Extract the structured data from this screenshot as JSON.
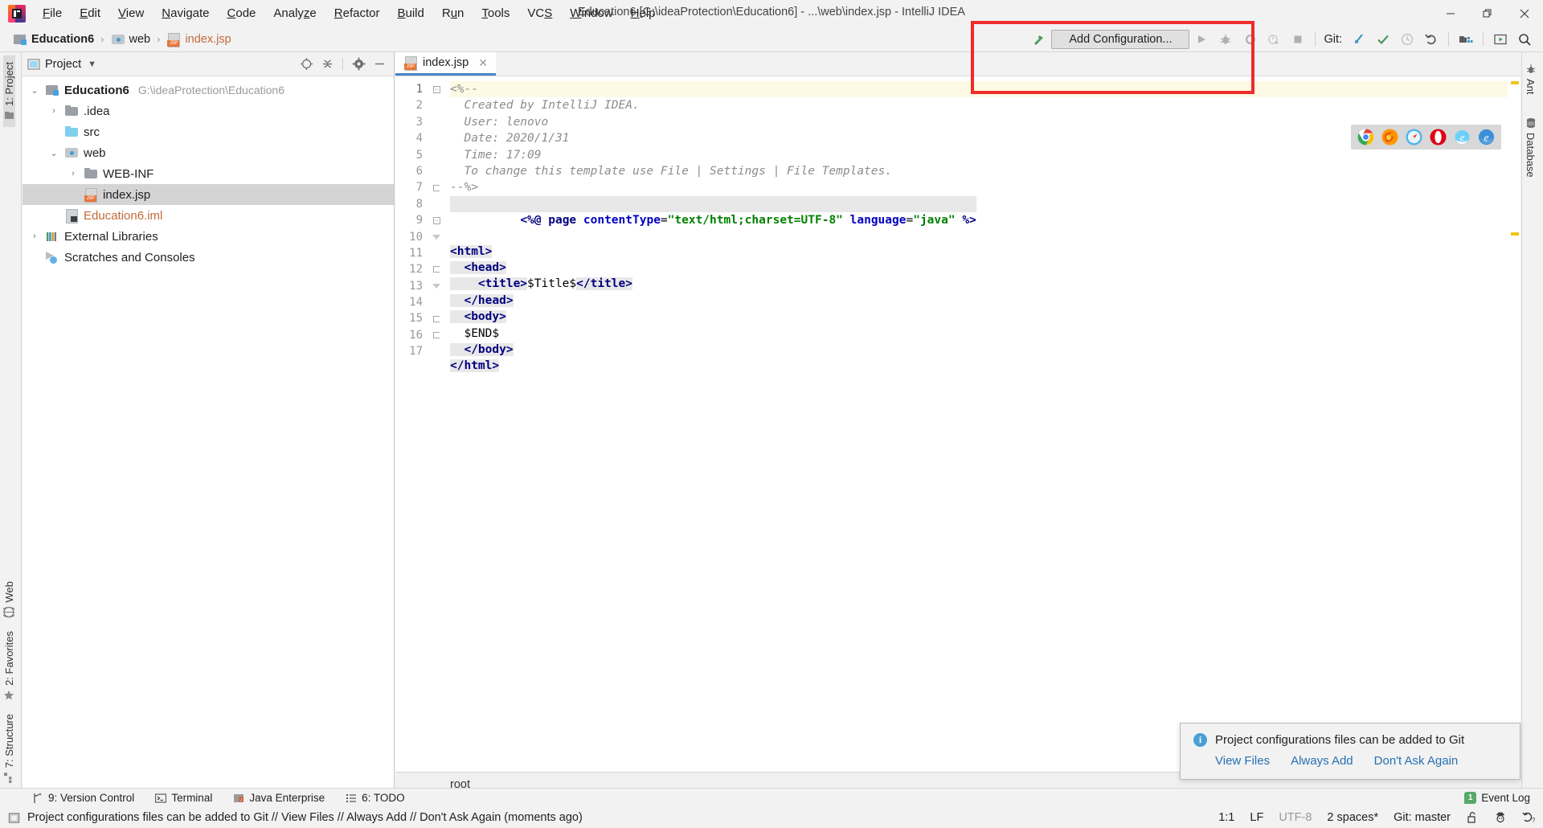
{
  "window": {
    "title": "Education6 [G:\\ideaProtection\\Education6] - ...\\web\\index.jsp - IntelliJ IDEA",
    "minimize_label": "—",
    "restore_label": "❐",
    "close_label": "✕"
  },
  "menu": {
    "items": [
      {
        "label": "File"
      },
      {
        "label": "Edit"
      },
      {
        "label": "View"
      },
      {
        "label": "Navigate"
      },
      {
        "label": "Code"
      },
      {
        "label": "Analyze"
      },
      {
        "label": "Refactor"
      },
      {
        "label": "Build"
      },
      {
        "label": "Run"
      },
      {
        "label": "Tools"
      },
      {
        "label": "VCS"
      },
      {
        "label": "Window"
      },
      {
        "label": "Help"
      }
    ]
  },
  "breadcrumb": {
    "items": [
      {
        "label": "Education6",
        "icon": "module-icon"
      },
      {
        "label": "web",
        "icon": "web-folder-icon"
      },
      {
        "label": "index.jsp",
        "icon": "jsp-file-icon"
      }
    ],
    "separator": "›"
  },
  "toolbar": {
    "build_icon": "hammer-icon",
    "add_configuration_label": "Add Configuration...",
    "run_icon": "run-icon",
    "debug_icon": "debug-icon",
    "run_coverage_icon": "run-with-coverage-icon",
    "profile_icon": "profiler-icon",
    "stop_icon": "stop-icon",
    "git_label": "Git:",
    "update_project_icon": "update-project-icon",
    "commit_icon": "commit-checkmark-icon",
    "history_icon": "history-clock-icon",
    "rollback_icon": "rollback-undo-icon",
    "project_structure_icon": "project-structure-icon",
    "preview_icon": "preview-icon",
    "search_everywhere_icon": "search-icon",
    "accent_green": "#59a869",
    "accent_blue": "#3592c4",
    "annotation_box_color": "#ef2b2b"
  },
  "left_tool_tabs": {
    "top": [
      {
        "label": "1: Project",
        "active": true,
        "icon": "project-icon"
      }
    ],
    "bottom": [
      {
        "label": "Web",
        "icon": "web-icon"
      },
      {
        "label": "2: Favorites",
        "icon": "star-icon"
      },
      {
        "label": "7: Structure",
        "icon": "structure-icon"
      }
    ]
  },
  "right_tool_tabs": {
    "items": [
      {
        "label": "Ant",
        "icon": "ant-icon"
      },
      {
        "label": "Database",
        "icon": "database-icon"
      }
    ]
  },
  "project_panel": {
    "title": "Project",
    "dropdown_icon": "chevron-down-icon",
    "locate_icon": "locate-target-icon",
    "collapse_icon": "collapse-all-icon",
    "settings_icon": "gear-icon",
    "hide_icon": "hide-minus-icon",
    "tree": [
      {
        "label": "Education6",
        "path": "G:\\ideaProtection\\Education6",
        "icon": "module-icon",
        "arrow": "⌄",
        "indent": 0,
        "bold": true,
        "selected": false
      },
      {
        "label": ".idea",
        "path": "",
        "icon": "folder-gray-icon",
        "arrow": "›",
        "indent": 1,
        "bold": false,
        "selected": false
      },
      {
        "label": "src",
        "path": "",
        "icon": "folder-blue-icon",
        "arrow": "",
        "indent": 1,
        "bold": false,
        "selected": false
      },
      {
        "label": "web",
        "path": "",
        "icon": "web-folder-icon",
        "arrow": "⌄",
        "indent": 1,
        "bold": false,
        "selected": false
      },
      {
        "label": "WEB-INF",
        "path": "",
        "icon": "folder-gray-icon",
        "arrow": "›",
        "indent": 2,
        "bold": false,
        "selected": false
      },
      {
        "label": "index.jsp",
        "path": "",
        "icon": "jsp-file-icon",
        "arrow": "",
        "indent": 2,
        "bold": false,
        "selected": true
      },
      {
        "label": "Education6.iml",
        "path": "",
        "icon": "iml-file-icon",
        "arrow": "",
        "indent": 1,
        "bold": false,
        "selected": false,
        "orange": true
      },
      {
        "label": "External Libraries",
        "path": "",
        "icon": "external-libraries-icon",
        "arrow": "›",
        "indent": 0,
        "bold": false,
        "selected": false
      },
      {
        "label": "Scratches and Consoles",
        "path": "",
        "icon": "scratches-icon",
        "arrow": "",
        "indent": 0,
        "bold": false,
        "selected": false
      }
    ]
  },
  "editor": {
    "tab": {
      "label": "index.jsp",
      "icon": "jsp-file-icon",
      "close_icon": "close-icon"
    },
    "breadcrumb_label": "root",
    "line_numbers": [
      "1",
      "2",
      "3",
      "4",
      "5",
      "6",
      "7",
      "8",
      "9",
      "10",
      "11",
      "12",
      "13",
      "14",
      "15",
      "16",
      "17"
    ],
    "lines": [
      {
        "n": 1,
        "current": true,
        "segments": [
          {
            "t": "<%--",
            "c": "com"
          }
        ]
      },
      {
        "n": 2,
        "current": false,
        "segments": [
          {
            "t": "  Created by IntelliJ IDEA.",
            "c": "com"
          }
        ]
      },
      {
        "n": 3,
        "current": false,
        "segments": [
          {
            "t": "  User: lenovo",
            "c": "com"
          }
        ]
      },
      {
        "n": 4,
        "current": false,
        "segments": [
          {
            "t": "  Date: 2020/1/31",
            "c": "com"
          }
        ]
      },
      {
        "n": 5,
        "current": false,
        "segments": [
          {
            "t": "  Time: 17:09",
            "c": "com"
          }
        ]
      },
      {
        "n": 6,
        "current": false,
        "segments": [
          {
            "t": "  To change this template use File | Settings | File Templates.",
            "c": "com"
          }
        ]
      },
      {
        "n": 7,
        "current": false,
        "segments": [
          {
            "t": "--%>",
            "c": "com"
          }
        ]
      },
      {
        "n": 8,
        "current": false,
        "segments": [
          {
            "t": "<%@ ",
            "c": "dir"
          },
          {
            "t": "page ",
            "c": "tag"
          },
          {
            "t": "contentType",
            "c": "attr"
          },
          {
            "t": "=",
            "c": "plain"
          },
          {
            "t": "\"text/html;charset=UTF-8\"",
            "c": "str"
          },
          {
            "t": " ",
            "c": "plain"
          },
          {
            "t": "language",
            "c": "attr"
          },
          {
            "t": "=",
            "c": "plain"
          },
          {
            "t": "\"java\"",
            "c": "str"
          },
          {
            "t": " %>",
            "c": "dir"
          }
        ]
      },
      {
        "n": 9,
        "current": false,
        "segments": [
          {
            "t": "<html>",
            "c": "tag"
          }
        ]
      },
      {
        "n": 10,
        "current": false,
        "segments": [
          {
            "t": "  <head>",
            "c": "tag"
          }
        ]
      },
      {
        "n": 11,
        "current": false,
        "segments": [
          {
            "t": "    <title>",
            "c": "tag"
          },
          {
            "t": "$Title$",
            "c": "plain"
          },
          {
            "t": "</title>",
            "c": "tag"
          }
        ]
      },
      {
        "n": 12,
        "current": false,
        "segments": [
          {
            "t": "  </head>",
            "c": "tag"
          }
        ]
      },
      {
        "n": 13,
        "current": false,
        "segments": [
          {
            "t": "  <body>",
            "c": "tag"
          }
        ]
      },
      {
        "n": 14,
        "current": false,
        "segments": [
          {
            "t": "  $END$",
            "c": "plain"
          }
        ]
      },
      {
        "n": 15,
        "current": false,
        "segments": [
          {
            "t": "  </body>",
            "c": "tag"
          }
        ]
      },
      {
        "n": 16,
        "current": false,
        "segments": [
          {
            "t": "</html>",
            "c": "tag"
          }
        ]
      },
      {
        "n": 17,
        "current": false,
        "segments": [
          {
            "t": "",
            "c": "plain"
          }
        ]
      }
    ],
    "browsers": [
      {
        "name": "chrome-icon",
        "color": "#4285f4"
      },
      {
        "name": "firefox-icon",
        "color": "#e66000"
      },
      {
        "name": "safari-icon",
        "color": "#3aa0e8"
      },
      {
        "name": "opera-icon",
        "color": "#d5000f"
      },
      {
        "name": "internet-explorer-icon",
        "color": "#5bc8f5"
      },
      {
        "name": "edge-icon",
        "color": "#2c8ed8"
      }
    ],
    "marker_warning_color": "#f0c419",
    "marker_ok_color": "#f0c419"
  },
  "notification": {
    "icon": "info-icon",
    "message": "Project configurations files can be added to Git",
    "links": [
      "View Files",
      "Always Add",
      "Don't Ask Again"
    ]
  },
  "bottom_tool_windows": {
    "items": [
      {
        "label": "9: Version Control",
        "icon": "vcs-branch-icon"
      },
      {
        "label": "Terminal",
        "icon": "terminal-icon"
      },
      {
        "label": "Java Enterprise",
        "icon": "java-enterprise-icon"
      },
      {
        "label": "6: TODO",
        "icon": "todo-list-icon"
      }
    ],
    "event_log": {
      "label": "Event Log",
      "badge": "1",
      "badge_color": "#59a869"
    }
  },
  "status_bar": {
    "message_icon": "message-icon",
    "message": "Project configurations files can be added to Git // View Files // Always Add // Don't Ask Again (moments ago)",
    "caret_position": "1:1",
    "line_separator": "LF",
    "encoding": "UTF-8",
    "indent": "2 spaces*",
    "git_branch": "Git: master",
    "lock_icon": "unlocked-padlock-icon",
    "inspector_icon": "hector-inspector-icon",
    "ide_update_icon": "ide-settings-icon"
  }
}
